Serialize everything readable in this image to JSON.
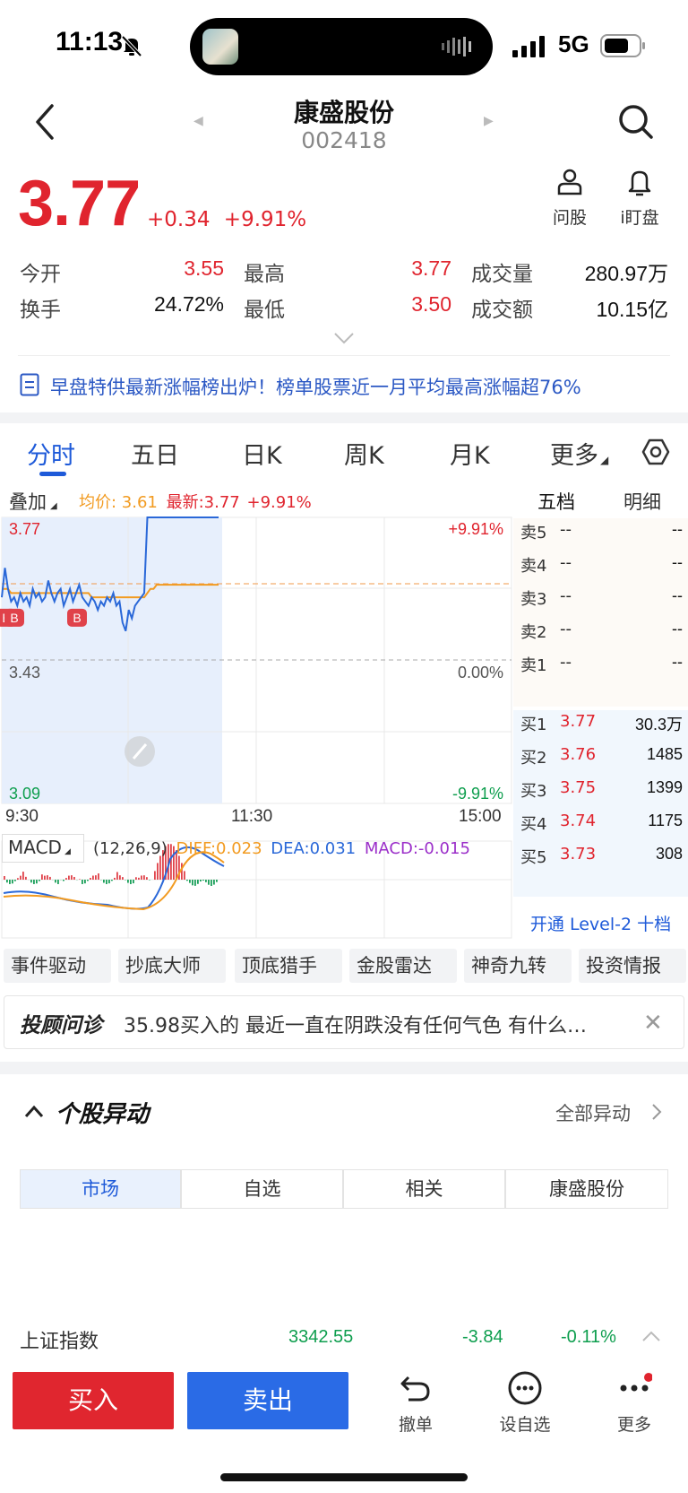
{
  "status_bar": {
    "time": "11:13",
    "network": "5G"
  },
  "header": {
    "stock_name": "康盛股份",
    "stock_code": "002418"
  },
  "quote": {
    "price": "3.77",
    "change": "+0.34",
    "change_pct": "+9.91%",
    "accent_up": "#e0242e",
    "accent_down": "#0e9e4e"
  },
  "tools": [
    {
      "label": "问股",
      "icon": "user-icon"
    },
    {
      "label": "i盯盘",
      "icon": "bell-icon"
    }
  ],
  "stats": {
    "open_label": "今开",
    "open": "3.55",
    "high_label": "最高",
    "high": "3.77",
    "volume_label": "成交量",
    "volume": "280.97万",
    "turnover_label": "换手",
    "turnover": "24.72%",
    "low_label": "最低",
    "low": "3.50",
    "amount_label": "成交额",
    "amount": "10.15亿"
  },
  "notice": "早盘特供最新涨幅榜出炉！榜单股票近一月平均最高涨幅超76%",
  "tabs": [
    "分时",
    "五日",
    "日K",
    "周K",
    "月K",
    "更多"
  ],
  "chart_bar": {
    "overlay": "叠加",
    "avg_price": "均价: 3.61",
    "latest": "最新:3.77",
    "latest_pct": "+9.91%",
    "right_tabs": [
      "五档",
      "明细"
    ]
  },
  "chart_data": {
    "type": "line",
    "y_labels_left": [
      "3.77",
      "3.43",
      "3.09"
    ],
    "y_labels_right": [
      "+9.91%",
      "0.00%",
      "-9.91%"
    ],
    "x_labels": [
      "9:30",
      "11:30",
      "15:00"
    ],
    "ylim": [
      3.09,
      3.77
    ],
    "prev_close": 3.43,
    "price_series": [
      3.58,
      3.65,
      3.6,
      3.57,
      3.58,
      3.56,
      3.59,
      3.57,
      3.58,
      3.56,
      3.6,
      3.58,
      3.59,
      3.57,
      3.58,
      3.62,
      3.59,
      3.57,
      3.59,
      3.6,
      3.56,
      3.58,
      3.6,
      3.57,
      3.59,
      3.61,
      3.58,
      3.57,
      3.56,
      3.58,
      3.57,
      3.55,
      3.57,
      3.56,
      3.58,
      3.57,
      3.59,
      3.56,
      3.57,
      3.52,
      3.5,
      3.55,
      3.53,
      3.56,
      3.57,
      3.58,
      3.59,
      3.77,
      3.77,
      3.77,
      3.77,
      3.77,
      3.77,
      3.77,
      3.77,
      3.77,
      3.77,
      3.77,
      3.77,
      3.77,
      3.77,
      3.77,
      3.77,
      3.77,
      3.77,
      3.77,
      3.77,
      3.77,
      3.77,
      3.77,
      3.77
    ],
    "avg_series": [
      3.6,
      3.6,
      3.6,
      3.59,
      3.59,
      3.59,
      3.59,
      3.59,
      3.59,
      3.59,
      3.59,
      3.59,
      3.59,
      3.59,
      3.59,
      3.59,
      3.59,
      3.59,
      3.59,
      3.59,
      3.59,
      3.59,
      3.59,
      3.59,
      3.59,
      3.59,
      3.59,
      3.59,
      3.59,
      3.58,
      3.58,
      3.58,
      3.58,
      3.58,
      3.58,
      3.58,
      3.58,
      3.58,
      3.58,
      3.58,
      3.58,
      3.58,
      3.58,
      3.58,
      3.58,
      3.58,
      3.58,
      3.59,
      3.6,
      3.6,
      3.61,
      3.61,
      3.61,
      3.61,
      3.61,
      3.61,
      3.61,
      3.61,
      3.61,
      3.61,
      3.61,
      3.61,
      3.61,
      3.61,
      3.61,
      3.61,
      3.61,
      3.61,
      3.61,
      3.61,
      3.61
    ],
    "total_minutes": 240,
    "buy_markers": [
      "B",
      "B",
      "B"
    ],
    "macd": {
      "label": "MACD",
      "params": "(12,26,9)",
      "diff": "DIFF:0.023",
      "dea": "DEA:0.031",
      "macd": "MACD:-0.015"
    }
  },
  "order_book": {
    "asks": [
      {
        "label": "卖5",
        "price": "--",
        "vol": "--"
      },
      {
        "label": "卖4",
        "price": "--",
        "vol": "--"
      },
      {
        "label": "卖3",
        "price": "--",
        "vol": "--"
      },
      {
        "label": "卖2",
        "price": "--",
        "vol": "--"
      },
      {
        "label": "卖1",
        "price": "--",
        "vol": "--"
      }
    ],
    "bids": [
      {
        "label": "买1",
        "price": "3.77",
        "vol": "30.3万"
      },
      {
        "label": "买2",
        "price": "3.76",
        "vol": "1485"
      },
      {
        "label": "买3",
        "price": "3.75",
        "vol": "1399"
      },
      {
        "label": "买4",
        "price": "3.74",
        "vol": "1175"
      },
      {
        "label": "买5",
        "price": "3.73",
        "vol": "308"
      }
    ],
    "level2": "开通 Level-2 十档"
  },
  "strategies": [
    "事件驱动",
    "抄底大师",
    "顶底猎手",
    "金股雷达",
    "神奇九转",
    "投资情报"
  ],
  "advisor": {
    "title": "投顾问诊",
    "text": "35.98买入的 最近一直在阴跌没有任何气色 有什么…"
  },
  "anomaly": {
    "title": "个股异动",
    "all_label": "全部异动",
    "segments": [
      "市场",
      "自选",
      "相关",
      "康盛股份"
    ]
  },
  "index_row": {
    "name": "上证指数",
    "value": "3342.55",
    "change": "-3.84",
    "change_pct": "-0.11%"
  },
  "bottom_bar": {
    "buy": "买入",
    "sell": "卖出",
    "actions": [
      {
        "label": "撤单",
        "icon": "undo-icon"
      },
      {
        "label": "设自选",
        "icon": "dots-circle-icon"
      },
      {
        "label": "更多",
        "icon": "more-icon"
      }
    ]
  }
}
